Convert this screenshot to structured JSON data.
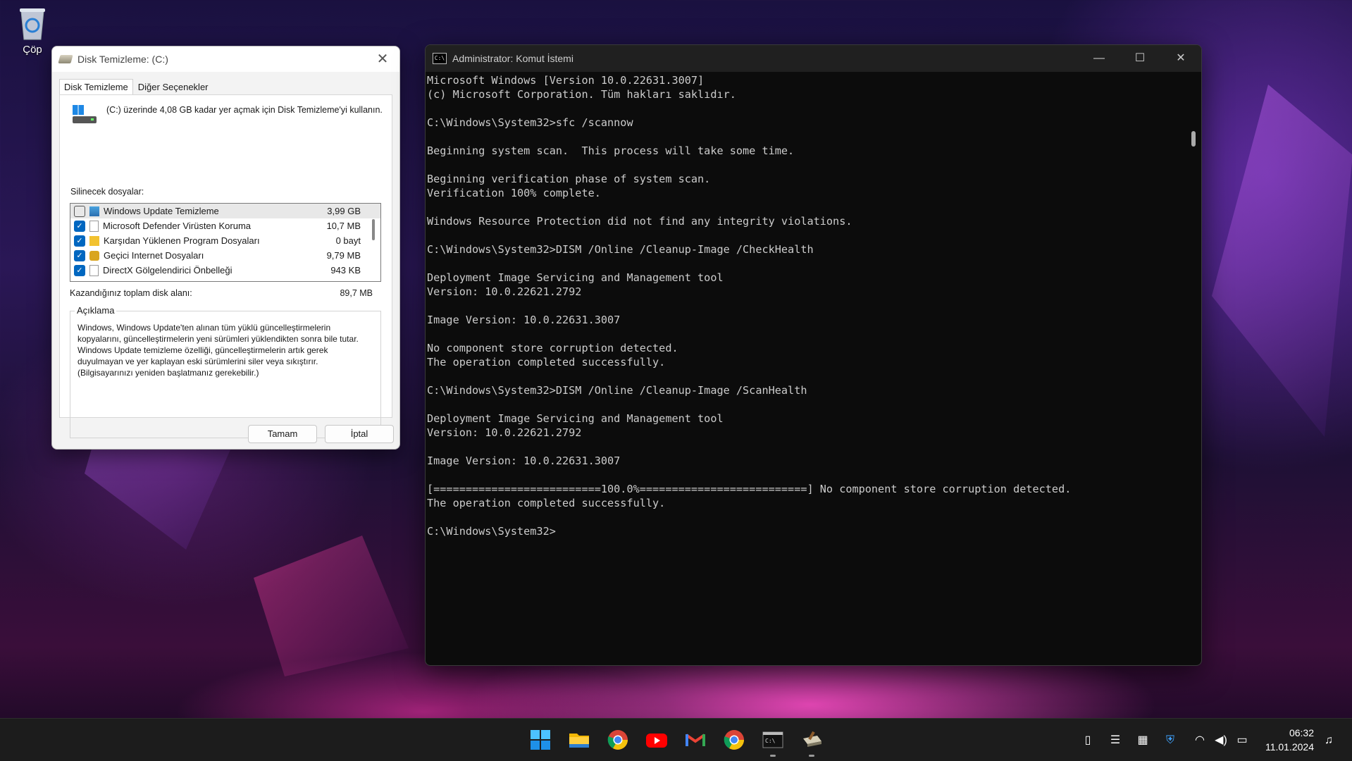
{
  "desktop": {
    "recycle_bin_label": "Çöp"
  },
  "disk_cleanup": {
    "title": "Disk Temizleme:  (C:)",
    "tabs": [
      "Disk Temizleme",
      "Diğer Seçenekler"
    ],
    "intro_text": "(C:) üzerinde 4,08 GB kadar yer açmak için Disk Temizleme'yi kullanın.",
    "files_label": "Silinecek dosyalar:",
    "files": [
      {
        "name": "Windows Update Temizleme",
        "size": "3,99 GB",
        "checked": false,
        "icon": "update-icon"
      },
      {
        "name": "Microsoft Defender Virüsten Koruma",
        "size": "10,7 MB",
        "checked": true,
        "icon": "file-icon"
      },
      {
        "name": "Karşıdan Yüklenen Program Dosyaları",
        "size": "0 bayt",
        "checked": true,
        "icon": "folder-icon"
      },
      {
        "name": "Geçici Internet Dosyaları",
        "size": "9,79 MB",
        "checked": true,
        "icon": "lock-icon"
      },
      {
        "name": "DirectX Gölgelendirici Önbelleği",
        "size": "943 KB",
        "checked": true,
        "icon": "file-icon"
      }
    ],
    "total_label": "Kazandığınız toplam disk alanı:",
    "total_value": "89,7 MB",
    "description_title": "Açıklama",
    "description_text": "Windows, Windows Update'ten alınan tüm yüklü güncelleştirmelerin kopyalarını, güncelleştirmelerin yeni sürümleri yüklendikten sonra bile tutar. Windows Update temizleme özelliği, güncelleştirmelerin artık gerek duyulmayan ve yer kaplayan eski sürümlerini siler veya sıkıştırır. (Bilgisayarınızı yeniden başlatmanız gerekebilir.)",
    "ok_label": "Tamam",
    "cancel_label": "İptal"
  },
  "cmd": {
    "title": "Administrator: Komut İstemi",
    "lines": [
      "Microsoft Windows [Version 10.0.22631.3007]",
      "(c) Microsoft Corporation. Tüm hakları saklıdır.",
      "",
      "C:\\Windows\\System32>sfc /scannow",
      "",
      "Beginning system scan.  This process will take some time.",
      "",
      "Beginning verification phase of system scan.",
      "Verification 100% complete.",
      "",
      "Windows Resource Protection did not find any integrity violations.",
      "",
      "C:\\Windows\\System32>DISM /Online /Cleanup-Image /CheckHealth",
      "",
      "Deployment Image Servicing and Management tool",
      "Version: 10.0.22621.2792",
      "",
      "Image Version: 10.0.22631.3007",
      "",
      "No component store corruption detected.",
      "The operation completed successfully.",
      "",
      "C:\\Windows\\System32>DISM /Online /Cleanup-Image /ScanHealth",
      "",
      "Deployment Image Servicing and Management tool",
      "Version: 10.0.22621.2792",
      "",
      "Image Version: 10.0.22631.3007",
      "",
      "[==========================100.0%==========================] No component store corruption detected.",
      "The operation completed successfully.",
      "",
      "C:\\Windows\\System32>"
    ]
  },
  "taskbar": {
    "apps": [
      "start-icon",
      "file-explorer-icon",
      "chrome-icon",
      "youtube-icon",
      "gmail-icon",
      "chrome-icon",
      "terminal-icon",
      "disk-cleanup-icon"
    ],
    "tray_icons": [
      "usb-icon",
      "settings-icon",
      "stats-icon",
      "defender-icon",
      "wifi-icon",
      "volume-icon",
      "battery-icon"
    ],
    "time": "06:32",
    "date": "11.01.2024"
  }
}
